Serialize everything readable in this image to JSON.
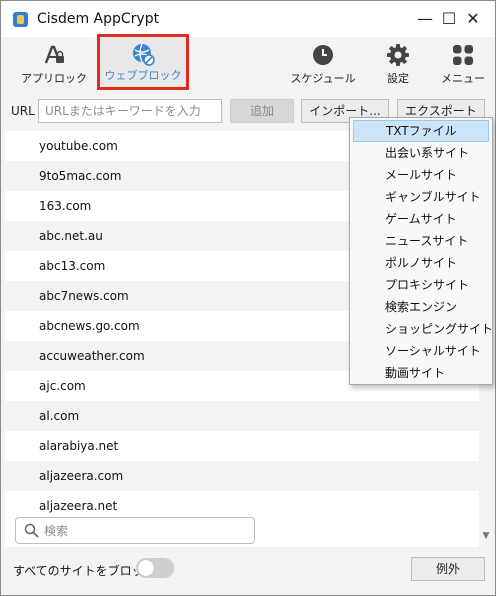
{
  "window": {
    "title": "Cisdem AppCrypt",
    "minimize_glyph": "—",
    "maximize_glyph": "☐",
    "close_glyph": "✕"
  },
  "toolbar": {
    "app_lock": {
      "label": "アプリロック",
      "icon": "app-lock-icon"
    },
    "web_block": {
      "label": "ウェブブロック",
      "icon": "web-block-icon",
      "active": true
    },
    "schedule": {
      "label": "スケジュール",
      "icon": "clock-icon"
    },
    "settings": {
      "label": "設定",
      "icon": "gear-icon"
    },
    "menu": {
      "label": "メニュー",
      "icon": "grid-icon"
    }
  },
  "url_bar": {
    "label": "URL",
    "placeholder": "URLまたはキーワードを入力",
    "add_button": "追加",
    "import_button": "インポート...",
    "export_button": "エクスポート"
  },
  "sites": [
    "youtube.com",
    "9to5mac.com",
    "163.com",
    "abc.net.au",
    "abc13.com",
    "abc7news.com",
    "abcnews.go.com",
    "accuweather.com",
    "ajc.com",
    "al.com",
    "alarabiya.net",
    "aljazeera.com",
    "aljazeera.net"
  ],
  "search": {
    "placeholder": "検索"
  },
  "footer": {
    "block_all_label": "すべてのサイトをブロック",
    "block_all_enabled": false,
    "exception_button": "例外"
  },
  "import_menu": {
    "highlighted_index": 0,
    "items": [
      "TXTファイル",
      "出会い系サイト",
      "メールサイト",
      "ギャンブルサイト",
      "ゲームサイト",
      "ニュースサイト",
      "ポルノサイト",
      "プロキシサイト",
      "検索エンジン",
      "ショッピングサイト",
      "ソーシャルサイト",
      "動画サイト"
    ]
  },
  "colors": {
    "accent_blue": "#3b86d4",
    "highlight_red": "#e02b20",
    "menu_highlight": "#cce4f7"
  }
}
